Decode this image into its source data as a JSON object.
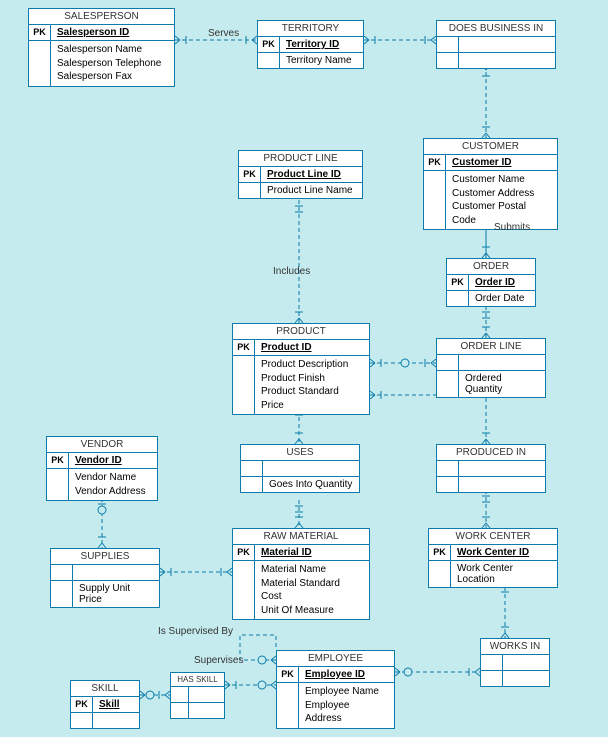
{
  "entities": {
    "salesperson": {
      "title": "SALESPERSON",
      "pk_label": "PK",
      "pk_attr": "Salesperson ID",
      "attrs": "Salesperson Name\nSalesperson Telephone\nSalesperson Fax"
    },
    "territory": {
      "title": "TERRITORY",
      "pk_label": "PK",
      "pk_attr": "Territory ID",
      "attrs": "Territory Name"
    },
    "does_business_in": {
      "title": "DOES BUSINESS IN"
    },
    "customer": {
      "title": "CUSTOMER",
      "pk_label": "PK",
      "pk_attr": "Customer ID",
      "attrs": "Customer Name\nCustomer Address\nCustomer Postal Code"
    },
    "product_line": {
      "title": "PRODUCT LINE",
      "pk_label": "PK",
      "pk_attr": "Product Line ID",
      "attrs": "Product Line Name"
    },
    "order": {
      "title": "ORDER",
      "pk_label": "PK",
      "pk_attr": "Order ID",
      "attrs": "Order Date"
    },
    "product": {
      "title": "PRODUCT",
      "pk_label": "PK",
      "pk_attr": "Product ID",
      "attrs": "Product Description\nProduct Finish\nProduct Standard Price"
    },
    "order_line": {
      "title": "ORDER LINE",
      "attrs": "Ordered Quantity"
    },
    "vendor": {
      "title": "VENDOR",
      "pk_label": "PK",
      "pk_attr": "Vendor ID",
      "attrs": "Vendor Name\nVendor Address"
    },
    "uses": {
      "title": "USES",
      "attrs": "Goes Into Quantity"
    },
    "produced_in": {
      "title": "PRODUCED IN"
    },
    "supplies": {
      "title": "SUPPLIES",
      "attrs": "Supply Unit Price"
    },
    "raw_material": {
      "title": "RAW MATERIAL",
      "pk_label": "PK",
      "pk_attr": "Material ID",
      "attrs": "Material Name\nMaterial Standard Cost\nUnit Of Measure"
    },
    "work_center": {
      "title": "WORK CENTER",
      "pk_label": "PK",
      "pk_attr": "Work Center ID",
      "attrs": "Work Center Location"
    },
    "employee": {
      "title": "EMPLOYEE",
      "pk_label": "PK",
      "pk_attr": "Employee ID",
      "attrs": "Employee Name\nEmployee Address"
    },
    "works_in": {
      "title": "WORKS IN"
    },
    "skill": {
      "title": "SKILL",
      "pk_label": "PK",
      "pk_attr": "Skill"
    },
    "has_skill": {
      "title": "HAS SKILL"
    }
  },
  "labels": {
    "serves": "Serves",
    "includes": "Includes",
    "submits": "Submits",
    "is_supervised_by": "Is Supervised By",
    "supervises": "Supervises"
  }
}
